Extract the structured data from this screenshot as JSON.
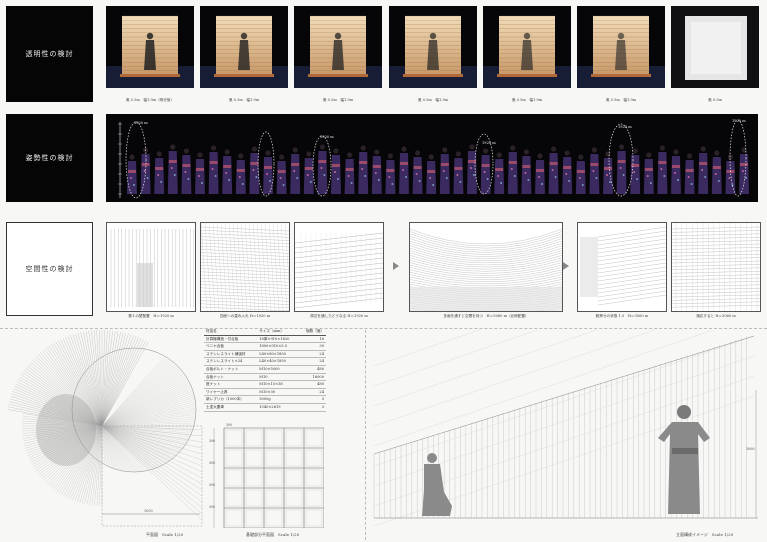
{
  "rows": {
    "transparency": {
      "label": "透明性の検討",
      "captions": [
        "奥 0.3m　幅1.9m（明光後）",
        "奥 0.3m　幅1.9m",
        "奥 0.5m　幅1.9m",
        "奥 0.5m　幅1.9m",
        "奥 0.5m　幅1.9m",
        "奥 0.5m　幅1.9m",
        "奥 0.5m"
      ]
    },
    "posture": {
      "label": "姿勢性の検討",
      "annotations": [
        "1920 m",
        "1920 m",
        "1920 m",
        "1920 m",
        "1920 m"
      ]
    },
    "space": {
      "label": "空間性の検討",
      "captions": [
        "第１の壁配置　H＝1920 m",
        "四面への重み入れ H＝1920 m",
        "周辺を通したどうなる H＝1920 m",
        "多面を通すと空間を持つ　H＝3060 m（北側配置）",
        "腕押せの状態 1.5　H＝3060 m",
        "適応すると H＝3060 m"
      ]
    }
  },
  "bottom": {
    "materials_table": {
      "header": [
        "材品名",
        "サイズ（mm）",
        "個数（個）"
      ],
      "rows": [
        [
          "計算機構造・付合板",
          "18厚×910×1820",
          "16"
        ],
        [
          "ベニヤ合板",
          "1800×910×5.5",
          "30"
        ],
        [
          "ステンレスライト補強材",
          "L80×80×1850",
          "24"
        ],
        [
          "ステンレスライト×24",
          "L40×40×1850",
          "24"
        ],
        [
          "合板ボルト・ナット",
          "M10×5000",
          "480"
        ],
        [
          "合板ナット",
          "M10",
          "16000"
        ],
        [
          "座ナット",
          "M10×15×38",
          "480"
        ],
        [
          "ワイヤー止具",
          "M10×30",
          "24"
        ],
        [
          "新レプリカ（1000本）",
          "3000g",
          "3"
        ],
        [
          "土塗大豊車",
          "1540×2619",
          "3"
        ]
      ]
    },
    "plan_caption": "平面図　Scale 1/20",
    "foundation_caption": "基礎部分平面図　Scale 1/20",
    "elevation_caption": "立面構成イメージ　Scale 1/20",
    "dims": {
      "plan_width": "1000",
      "foundation_side": [
        "300",
        "300",
        "300",
        "300"
      ],
      "foundation_top": "300",
      "elevation_height": "3060"
    }
  },
  "colors": {
    "photo_bg": "#060608",
    "label_bg": "#050505",
    "kimono": "#3a2a60",
    "glow": "#e8c79a"
  }
}
